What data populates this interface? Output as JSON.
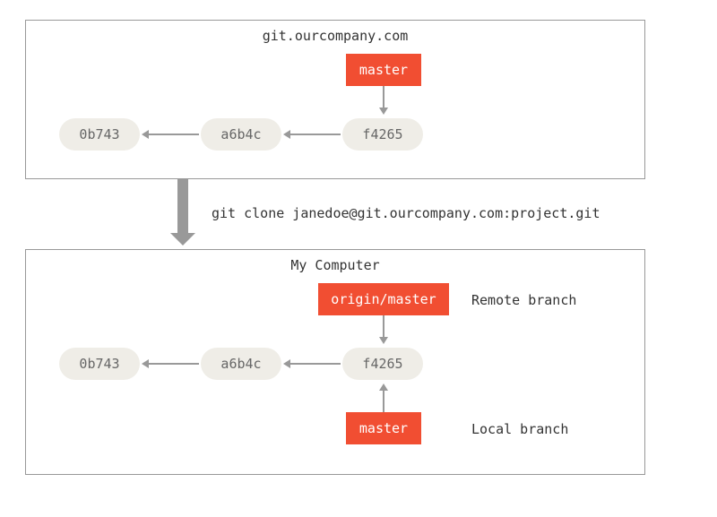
{
  "server": {
    "title": "git.ourcompany.com",
    "commits": [
      "0b743",
      "a6b4c",
      "f4265"
    ],
    "branch": "master"
  },
  "clone": {
    "command": "git clone janedoe@git.ourcompany.com:project.git"
  },
  "local": {
    "title": "My Computer",
    "commits": [
      "0b743",
      "a6b4c",
      "f4265"
    ],
    "remote_branch": "origin/master",
    "remote_branch_label": "Remote branch",
    "local_branch": "master",
    "local_branch_label": "Local branch"
  }
}
